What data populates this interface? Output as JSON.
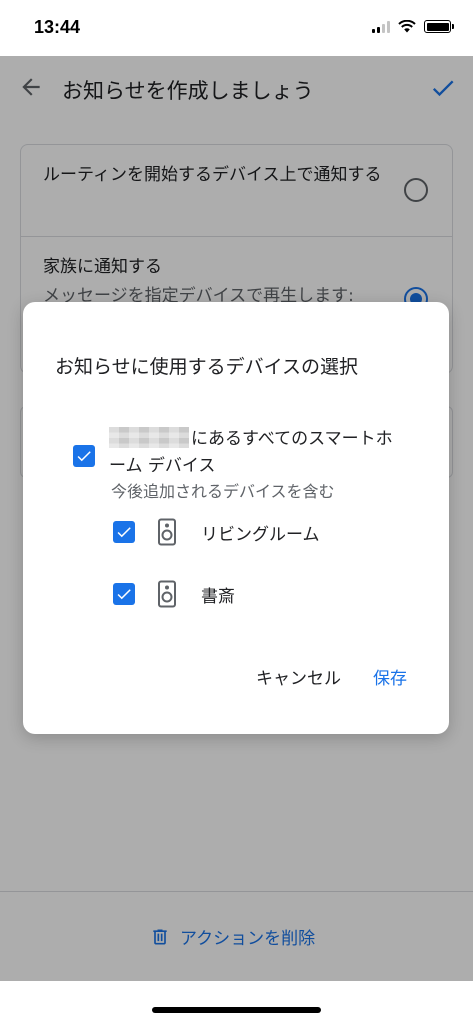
{
  "status_bar": {
    "time": "13:44"
  },
  "app_bar": {
    "title": "お知らせを作成しましょう"
  },
  "options": [
    {
      "label": "ルーティンを開始するデバイス上で通知する",
      "sublabel": "",
      "selected": false
    },
    {
      "label": "家族に通知する",
      "sublabel": "メッセージを指定デバイスで再生します:",
      "selected": true
    }
  ],
  "bottom_bar": {
    "delete_label": "アクションを削除"
  },
  "dialog": {
    "title": "お知らせに使用するデバイスの選択",
    "all_devices": {
      "label": "にあるすべてのスマートホーム デバイス",
      "sublabel": "今後追加されるデバイスを含む",
      "checked": true
    },
    "devices": [
      {
        "name": "リビングルーム",
        "icon": "speaker-icon",
        "checked": true
      },
      {
        "name": "書斎",
        "icon": "speaker-icon",
        "checked": true
      }
    ],
    "cancel_label": "キャンセル",
    "save_label": "保存"
  },
  "colors": {
    "accent": "#1a73e8",
    "text": "#202124",
    "secondary_text": "#5f6368"
  }
}
